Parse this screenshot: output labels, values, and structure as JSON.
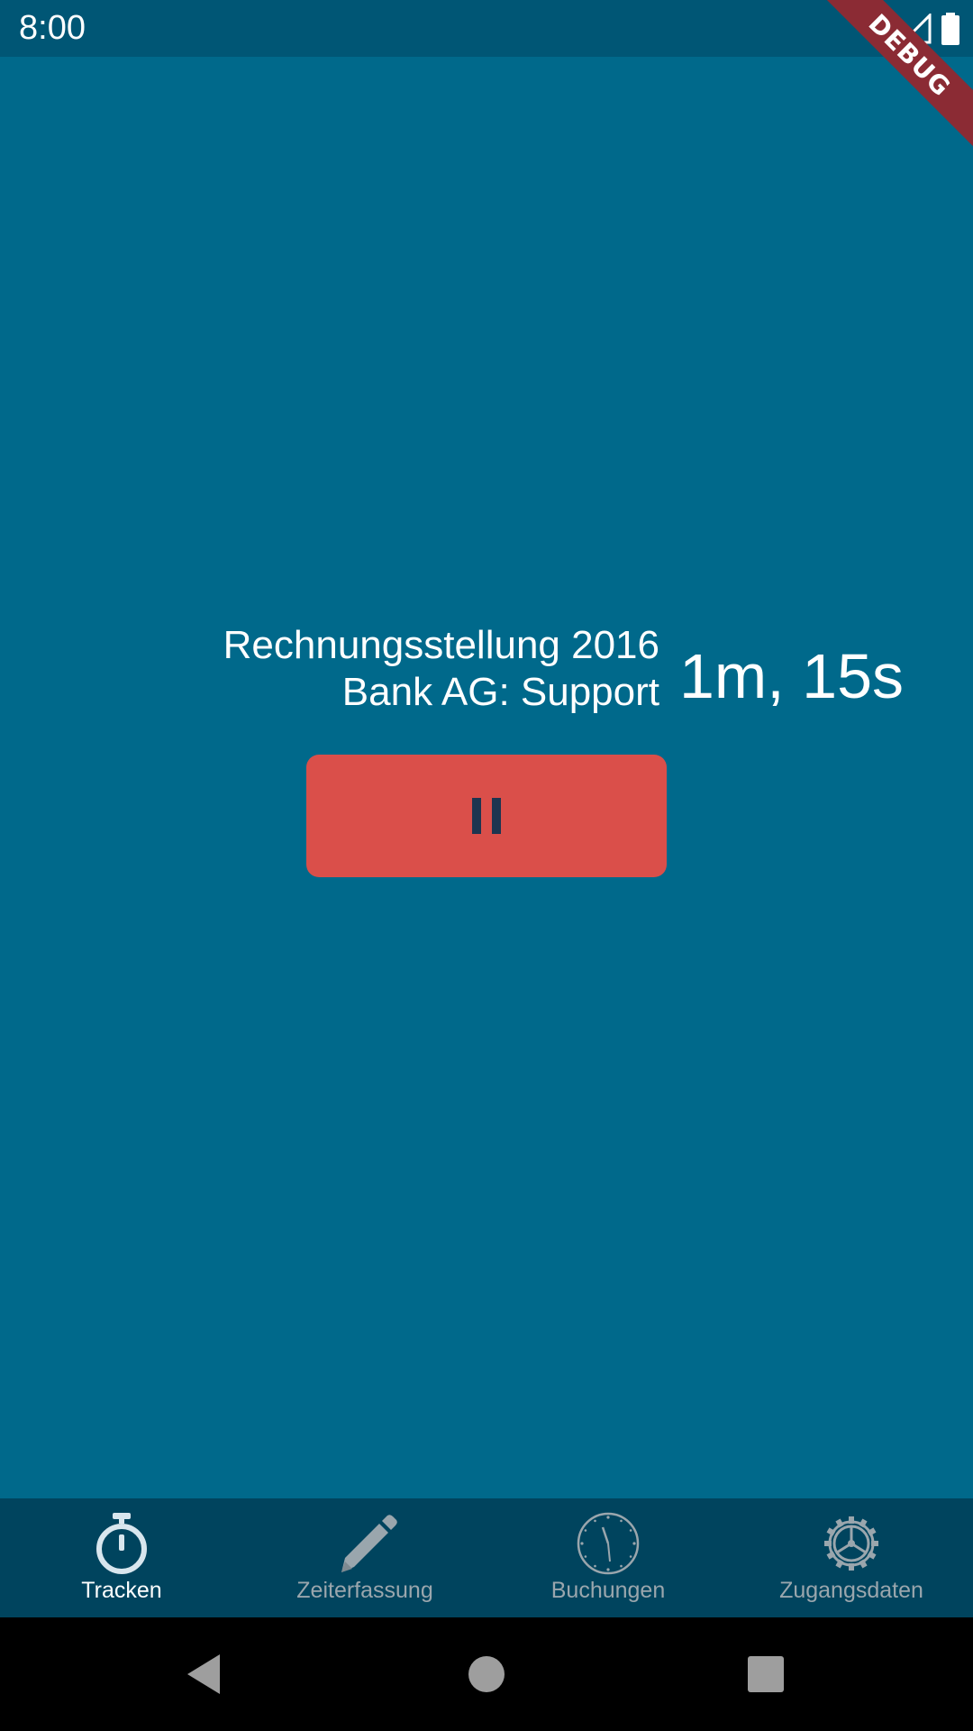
{
  "status_bar": {
    "time": "8:00",
    "icons": [
      "wifi-icon",
      "signal-icon",
      "battery-icon"
    ]
  },
  "debug_banner": {
    "label": "DEBUG"
  },
  "tracker": {
    "project": "Rechnungsstellung 2016",
    "task": "Bank AG: Support",
    "elapsed": "1m, 15s",
    "pause_icon": "pause-icon"
  },
  "bottom_nav": {
    "items": [
      {
        "label": "Tracken",
        "icon": "stopwatch-icon",
        "active": true
      },
      {
        "label": "Zeiterfassung",
        "icon": "pencil-icon",
        "active": false
      },
      {
        "label": "Buchungen",
        "icon": "clock-icon",
        "active": false
      },
      {
        "label": "Zugangsdaten",
        "icon": "gear-icon",
        "active": false
      }
    ]
  },
  "system_nav": {
    "buttons": [
      "back-icon",
      "home-icon",
      "recents-icon"
    ]
  },
  "colors": {
    "background": "#00698b",
    "status_bar": "#005675",
    "bottom_nav": "#00445e",
    "pause_button": "#da4f4a",
    "debug_banner": "#8b2b34"
  }
}
